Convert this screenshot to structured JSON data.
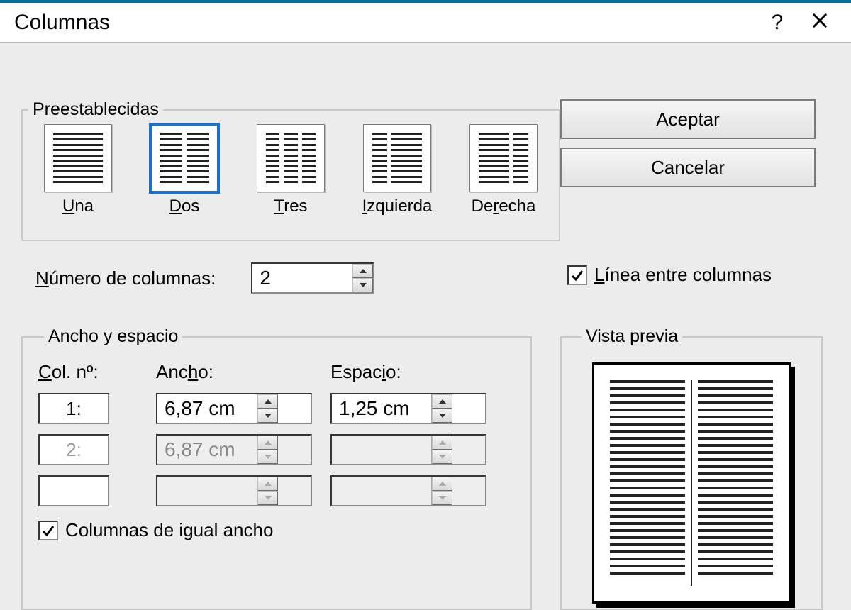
{
  "title": "Columnas",
  "buttons": {
    "ok": "Aceptar",
    "cancel": "Cancelar",
    "help": "?",
    "close": "×"
  },
  "presets": {
    "legend": "Preestablecidas",
    "items": [
      {
        "key": "una",
        "label_pre": "",
        "label_u": "U",
        "label_post": "na",
        "selected": false,
        "cols": [
          1
        ]
      },
      {
        "key": "dos",
        "label_pre": "",
        "label_u": "D",
        "label_post": "os",
        "selected": true,
        "cols": [
          1,
          1
        ]
      },
      {
        "key": "tres",
        "label_pre": "",
        "label_u": "T",
        "label_post": "res",
        "selected": false,
        "cols": [
          1,
          1,
          1
        ]
      },
      {
        "key": "izquierda",
        "label_pre": "",
        "label_u": "I",
        "label_post": "zquierda",
        "selected": false,
        "cols": [
          0.5,
          1
        ]
      },
      {
        "key": "derecha",
        "label_pre": "De",
        "label_u": "r",
        "label_post": "echa",
        "selected": false,
        "cols": [
          1,
          0.5
        ]
      }
    ]
  },
  "num_columns": {
    "label_pre": "",
    "label_u": "N",
    "label_post": "úmero de columnas:",
    "value": "2"
  },
  "line_between": {
    "checked": true,
    "label_pre": "",
    "label_u": "L",
    "label_post": "ínea entre columnas"
  },
  "width_space": {
    "legend": "Ancho y espacio",
    "head_col_pre": "",
    "head_col_u": "C",
    "head_col_post": "ol. nº:",
    "head_w_pre": "Anc",
    "head_w_u": "h",
    "head_w_post": "o:",
    "head_s_pre": "Espac",
    "head_s_u": "i",
    "head_s_post": "o:",
    "rows": [
      {
        "n": "1:",
        "width": "6,87 cm",
        "space": "1,25 cm",
        "disabled": false
      },
      {
        "n": "2:",
        "width": "6,87 cm",
        "space": "",
        "disabled": true
      },
      {
        "n": "",
        "width": "",
        "space": "",
        "disabled": true
      }
    ],
    "equal": {
      "checked": true,
      "label": "Columnas de igual ancho"
    }
  },
  "preview": {
    "legend": "Vista previa"
  }
}
